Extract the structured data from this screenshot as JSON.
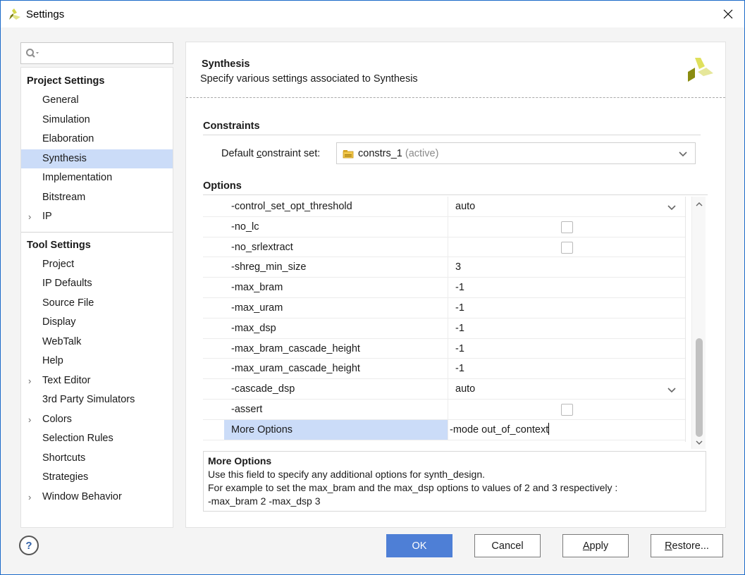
{
  "window": {
    "title": "Settings"
  },
  "search": {
    "placeholder": ""
  },
  "sidebar": {
    "groups": [
      {
        "header": "Project Settings",
        "items": [
          {
            "label": "General",
            "expandable": false,
            "selected": false
          },
          {
            "label": "Simulation",
            "expandable": false,
            "selected": false
          },
          {
            "label": "Elaboration",
            "expandable": false,
            "selected": false
          },
          {
            "label": "Synthesis",
            "expandable": false,
            "selected": true
          },
          {
            "label": "Implementation",
            "expandable": false,
            "selected": false
          },
          {
            "label": "Bitstream",
            "expandable": false,
            "selected": false
          },
          {
            "label": "IP",
            "expandable": true,
            "selected": false
          }
        ]
      },
      {
        "header": "Tool Settings",
        "items": [
          {
            "label": "Project",
            "expandable": false
          },
          {
            "label": "IP Defaults",
            "expandable": false
          },
          {
            "label": "Source File",
            "expandable": false
          },
          {
            "label": "Display",
            "expandable": false
          },
          {
            "label": "WebTalk",
            "expandable": false
          },
          {
            "label": "Help",
            "expandable": false
          },
          {
            "label": "Text Editor",
            "expandable": true
          },
          {
            "label": "3rd Party Simulators",
            "expandable": false
          },
          {
            "label": "Colors",
            "expandable": true
          },
          {
            "label": "Selection Rules",
            "expandable": false
          },
          {
            "label": "Shortcuts",
            "expandable": false
          },
          {
            "label": "Strategies",
            "expandable": false
          },
          {
            "label": "Window Behavior",
            "expandable": true
          }
        ]
      }
    ]
  },
  "page": {
    "title": "Synthesis",
    "subtitle": "Specify various settings associated to Synthesis"
  },
  "constraints": {
    "section_title": "Constraints",
    "label_pre": "Default ",
    "label_accel": "c",
    "label_post": "onstraint set:",
    "selected_value": "constrs_1",
    "selected_suffix": "(active)"
  },
  "options": {
    "section_title": "Options",
    "rows": [
      {
        "name": "-control_set_opt_threshold",
        "type": "dropdown",
        "value": "auto"
      },
      {
        "name": "-no_lc",
        "type": "checkbox",
        "checked": false
      },
      {
        "name": "-no_srlextract",
        "type": "checkbox",
        "checked": false
      },
      {
        "name": "-shreg_min_size",
        "type": "text",
        "value": "3"
      },
      {
        "name": "-max_bram",
        "type": "text",
        "value": "-1"
      },
      {
        "name": "-max_uram",
        "type": "text",
        "value": "-1"
      },
      {
        "name": "-max_dsp",
        "type": "text",
        "value": "-1"
      },
      {
        "name": "-max_bram_cascade_height",
        "type": "text",
        "value": "-1"
      },
      {
        "name": "-max_uram_cascade_height",
        "type": "text",
        "value": "-1"
      },
      {
        "name": "-cascade_dsp",
        "type": "dropdown",
        "value": "auto"
      },
      {
        "name": "-assert",
        "type": "checkbox",
        "checked": false
      },
      {
        "name": "More Options",
        "type": "edit",
        "value": "-mode out_of_context",
        "selected": true
      }
    ]
  },
  "description": {
    "title": "More Options",
    "lines": [
      "Use this field to specify any additional options for synth_design.",
      "For example to set the max_bram and the max_dsp options to values of 2 and 3 respectively :",
      "-max_bram 2 -max_dsp 3"
    ]
  },
  "footer": {
    "help_label": "?",
    "ok_label": "OK",
    "cancel_label": "Cancel",
    "apply_accel": "A",
    "apply_rest": "pply",
    "restore_accel": "R",
    "restore_rest": "estore..."
  },
  "colors": {
    "accent": "#4e7fd6",
    "selection": "#cbdcf8",
    "window_border": "#1b6ac9"
  }
}
